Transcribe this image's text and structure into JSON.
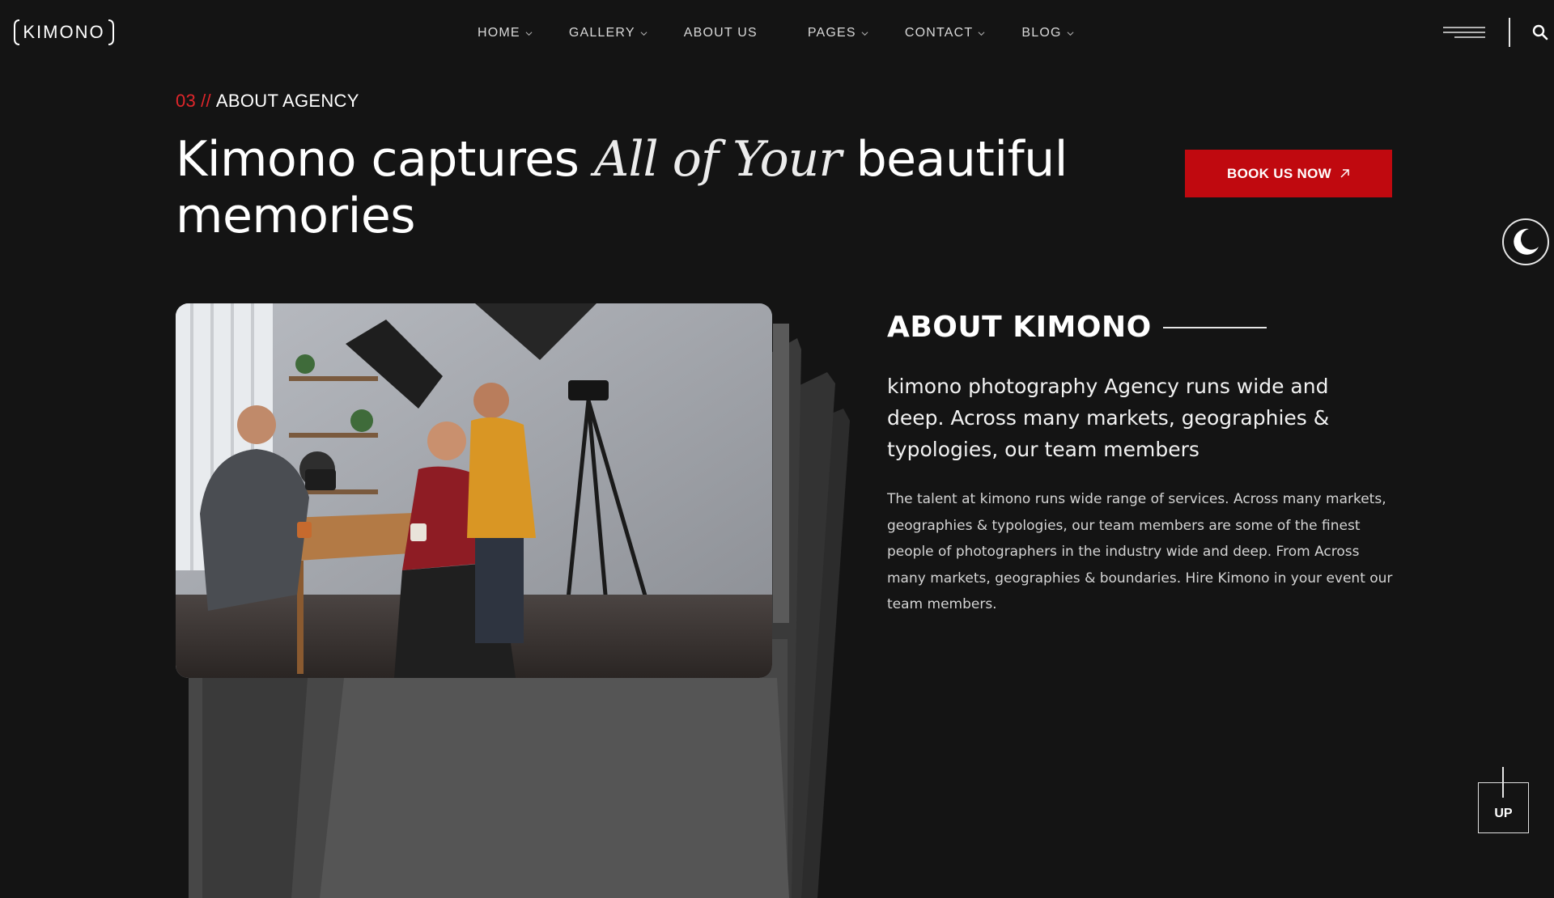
{
  "brand": {
    "logo_text": "KIMONO"
  },
  "nav": {
    "items": [
      {
        "label": "HOME",
        "has_dropdown": true
      },
      {
        "label": "GALLERY",
        "has_dropdown": true
      },
      {
        "label": "ABOUT US",
        "has_dropdown": false
      },
      {
        "label": "PAGES",
        "has_dropdown": true
      },
      {
        "label": "CONTACT",
        "has_dropdown": true
      },
      {
        "label": "BLOG",
        "has_dropdown": true
      }
    ]
  },
  "hero": {
    "eyebrow_number": "03",
    "eyebrow_separator": "//",
    "eyebrow_text": "ABOUT AGENCY",
    "headline_part1": "Kimono captures",
    "headline_italic": "All of Your",
    "headline_part2": "beautiful memories",
    "cta_label": "BOOK US NOW"
  },
  "about": {
    "title": "ABOUT KIMONO",
    "lead": "kimono photography Agency runs wide and deep. Across many markets, geographies & typologies, our team members",
    "body": "The talent at kimono runs wide range of services. Across many markets, geographies & typologies, our team members are some of the finest people of photographers in the industry wide and deep. From Across many markets, geographies & boundaries. Hire Kimono in your event our team members."
  },
  "scroll_top": {
    "label": "UP"
  },
  "colors": {
    "accent": "#c0090f",
    "accent_text": "#e0262b",
    "background": "#141414"
  }
}
